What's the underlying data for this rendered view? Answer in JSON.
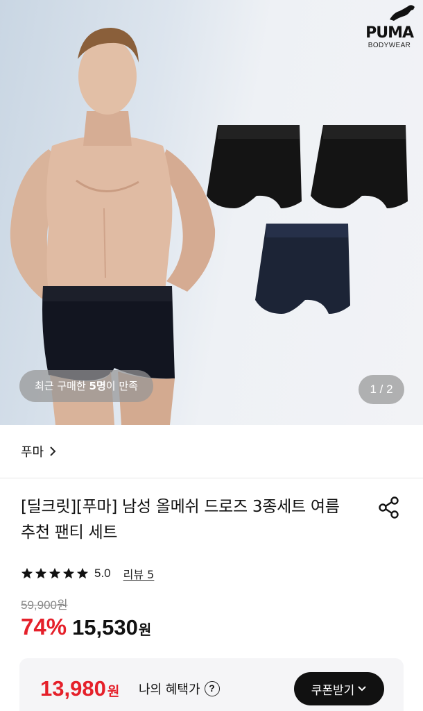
{
  "hero": {
    "brand": {
      "name": "PUMA",
      "sub": "BODYWEAR",
      "icon": "puma-cat-logo"
    },
    "buyers_prefix": "최근 구매한 ",
    "buyers_count": "5명",
    "buyers_suffix": "이 만족",
    "page_indicator": "1 / 2"
  },
  "brand_row": {
    "label": "푸마",
    "icon": "chevron-right-icon"
  },
  "product": {
    "title": "[딜크릿][푸마] 남성 올메쉬 드로즈 3종세트 여름 추천 팬티 세트",
    "share_icon": "share-icon",
    "rating": {
      "stars": 5,
      "score": "5.0",
      "review_label": "리뷰 5"
    },
    "original_price": "59,900원",
    "discount": "74%",
    "sale_price": "15,530",
    "currency": "원"
  },
  "benefit": {
    "price": "13,980",
    "currency": "원",
    "label": "나의 혜택가",
    "help_icon": "question-circle-icon",
    "coupon_button": "쿠폰받기",
    "coupon_chevron": "chevron-down-icon"
  },
  "colors": {
    "accent_red": "#e5202a",
    "dark": "#111111",
    "benefit_bg": "#f5f5f7"
  }
}
